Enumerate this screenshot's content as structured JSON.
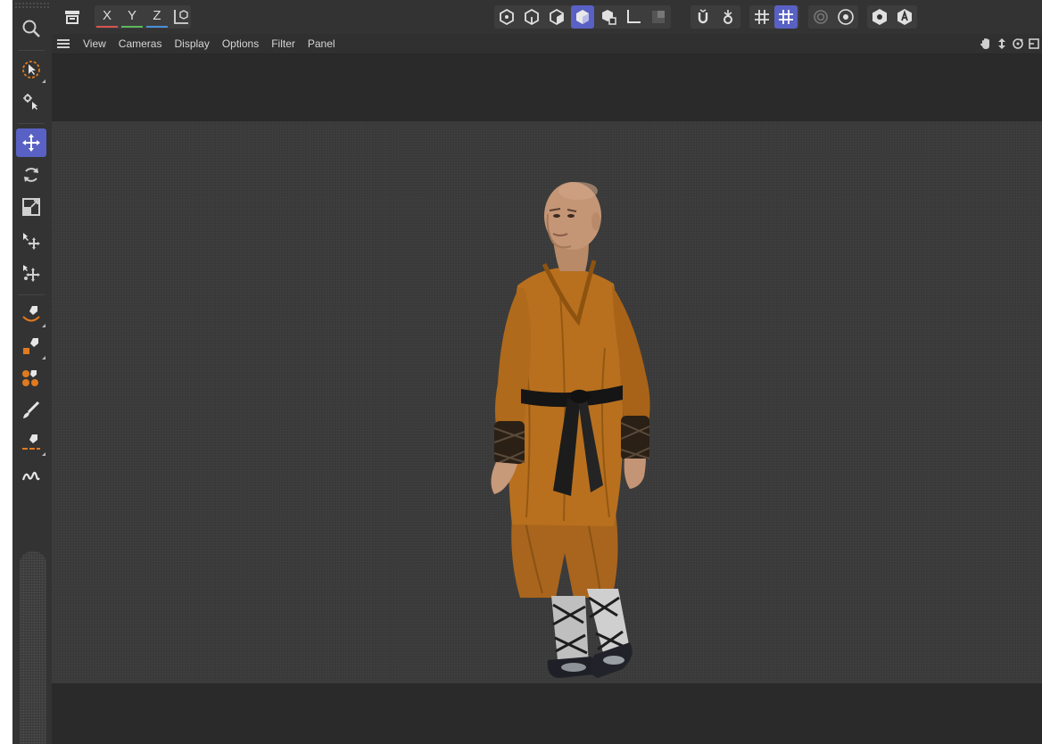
{
  "colors": {
    "accent": "#5961c4",
    "app_bg": "#2c2c2c",
    "toolbar_bg": "#333333",
    "viewport_bg": "#393939",
    "axis_x": "#d9534f",
    "axis_y": "#5cb85c",
    "axis_z": "#4a8fd9",
    "robe": "#b8701f",
    "orange_icon": "#e07a1f"
  },
  "left_toolbar": {
    "tools": [
      {
        "icon": "search-icon",
        "active": false
      },
      {
        "icon": "live-selection-icon",
        "active": false
      },
      {
        "icon": "move-select-icon",
        "active": false
      },
      {
        "icon": "move-icon",
        "active": true
      },
      {
        "icon": "rotate-icon",
        "active": false
      },
      {
        "icon": "scale-icon",
        "active": false
      },
      {
        "icon": "transform-move-icon",
        "active": false
      },
      {
        "icon": "transform-scale-icon",
        "active": false
      },
      {
        "icon": "spline-pen-icon",
        "active": false
      },
      {
        "icon": "spline-pen-orange-icon",
        "active": false
      },
      {
        "icon": "generator-icon",
        "active": false
      },
      {
        "icon": "brush-icon",
        "active": false
      },
      {
        "icon": "pen-line-icon",
        "active": false
      },
      {
        "icon": "sketch-icon",
        "active": false
      }
    ]
  },
  "top_toolbar": {
    "axis_x": "X",
    "axis_y": "Y",
    "axis_z": "Z",
    "icons": [
      "undo-view-icon",
      "world-coordinates-icon",
      "points-mode-icon",
      "edges-mode-icon",
      "polygons-mode-icon",
      "model-mode-icon",
      "object-mode-icon",
      "axis-mode-icon",
      "texture-mode-icon",
      "snap-icon",
      "snap-settings-icon",
      "grid-icon",
      "workplane-lock-icon",
      "render-active-icon",
      "render-settings-icon",
      "viewport-solo-icon",
      "auto-key-icon"
    ]
  },
  "viewport_menu": {
    "items": [
      "View",
      "Cameras",
      "Display",
      "Options",
      "Filter",
      "Panel"
    ],
    "nav_icons": [
      "pan-icon",
      "dolly-icon",
      "orbit-icon",
      "maximize-icon"
    ]
  }
}
